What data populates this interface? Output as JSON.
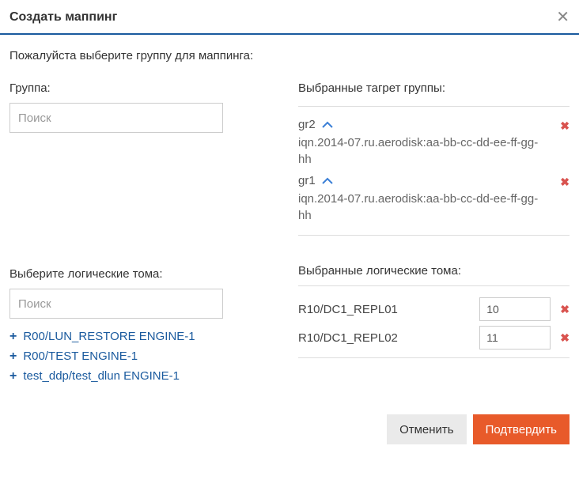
{
  "header": {
    "title": "Создать маппинг"
  },
  "instruction": "Пожалуйста выберите группу для маппинга:",
  "left": {
    "group_label": "Группа:",
    "group_search_placeholder": "Поиск",
    "luns_label": "Выберите логические тома:",
    "luns_search_placeholder": "Поиск",
    "lun_items": [
      "R00/LUN_RESTORE ENGINE-1",
      "R00/TEST ENGINE-1",
      "test_ddp/test_dlun ENGINE-1"
    ]
  },
  "right": {
    "target_groups_label": "Выбранные тагрет группы:",
    "groups": [
      {
        "name": "gr2",
        "iqn": "iqn.2014-07.ru.aerodisk:aa-bb-cc-dd-ee-ff-gg-hh"
      },
      {
        "name": "gr1",
        "iqn": "iqn.2014-07.ru.aerodisk:aa-bb-cc-dd-ee-ff-gg-hh"
      }
    ],
    "selected_luns_label": "Выбранные логические тома:",
    "selected_luns": [
      {
        "name": "R10/DC1_REPL01",
        "value": "10"
      },
      {
        "name": "R10/DC1_REPL02",
        "value": "11"
      }
    ]
  },
  "footer": {
    "cancel": "Отменить",
    "confirm": "Подтвердить"
  }
}
